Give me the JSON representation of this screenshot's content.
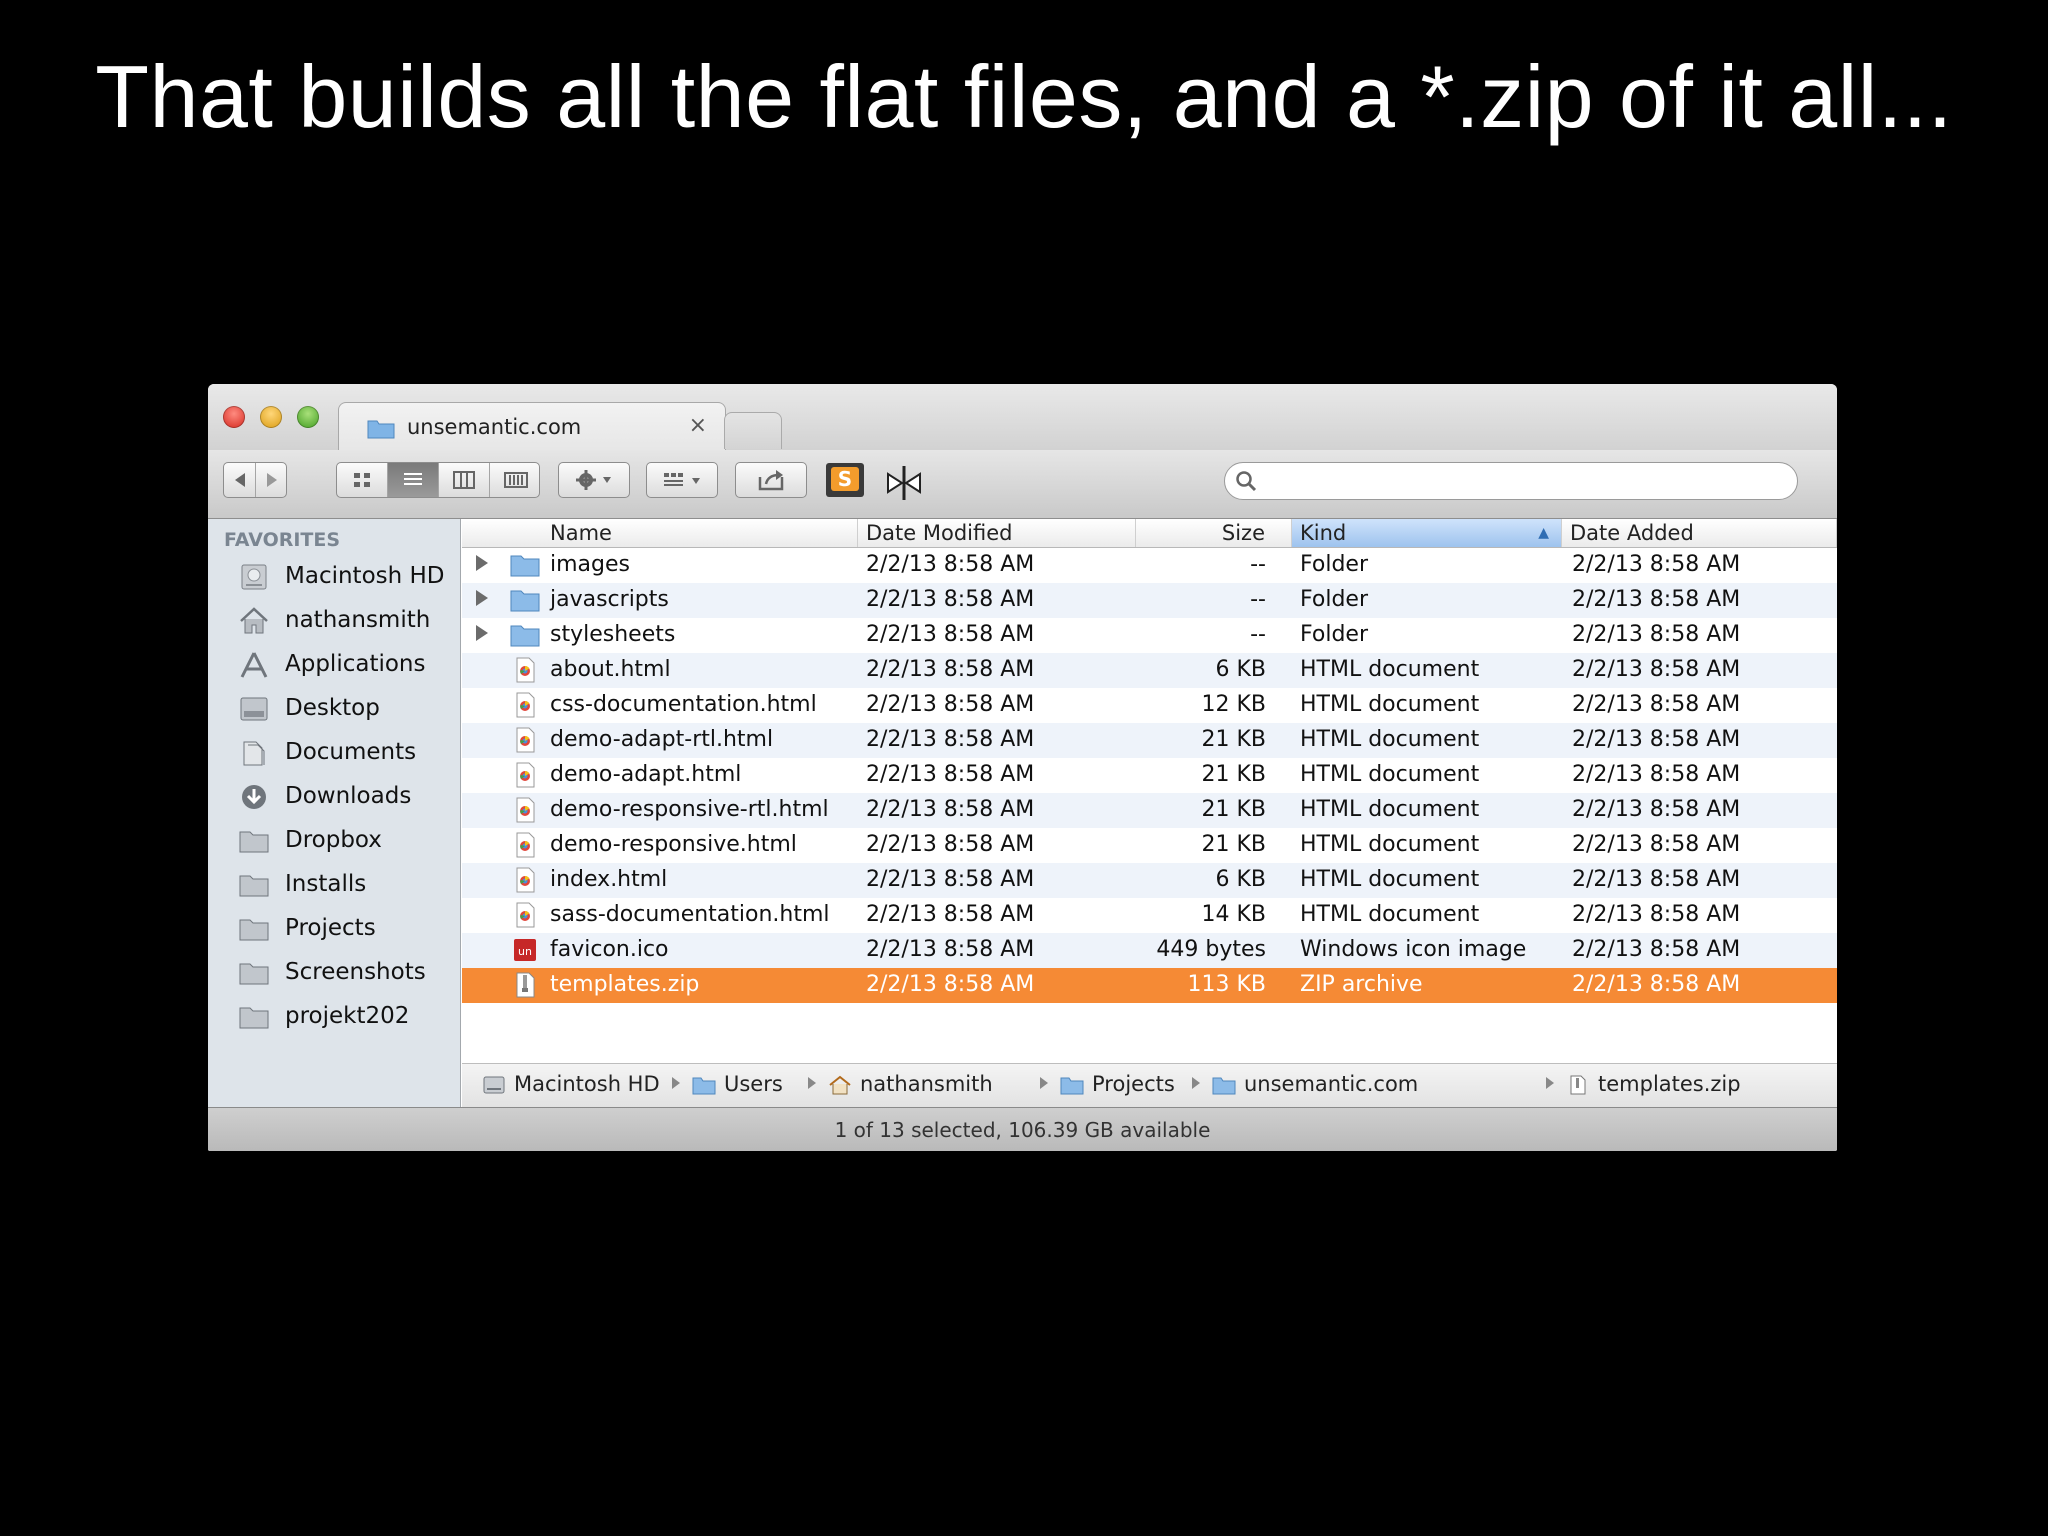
{
  "slide": {
    "title": "That builds all the flat files, and a *.zip of it all..."
  },
  "window": {
    "tab_title": "unsemantic.com",
    "tab_close": "×",
    "search_placeholder": ""
  },
  "sidebar": {
    "heading": "FAVORITES",
    "items": [
      {
        "label": "Macintosh HD",
        "icon": "hard-drive-icon"
      },
      {
        "label": "nathansmith",
        "icon": "home-icon"
      },
      {
        "label": "Applications",
        "icon": "applications-icon"
      },
      {
        "label": "Desktop",
        "icon": "desktop-icon"
      },
      {
        "label": "Documents",
        "icon": "documents-icon"
      },
      {
        "label": "Downloads",
        "icon": "downloads-icon"
      },
      {
        "label": "Dropbox",
        "icon": "folder-icon"
      },
      {
        "label": "Installs",
        "icon": "folder-icon"
      },
      {
        "label": "Projects",
        "icon": "folder-icon"
      },
      {
        "label": "Screenshots",
        "icon": "folder-icon"
      },
      {
        "label": "projekt202",
        "icon": "folder-icon"
      }
    ]
  },
  "list": {
    "columns": {
      "name": "Name",
      "date_modified": "Date Modified",
      "size": "Size",
      "kind": "Kind",
      "date_added": "Date Added"
    },
    "sorted_column": "Kind",
    "rows": [
      {
        "name": "images",
        "modified": "2/2/13 8:58 AM",
        "size": "--",
        "kind": "Folder",
        "added": "2/2/13 8:58 AM",
        "icon": "folder-icon"
      },
      {
        "name": "javascripts",
        "modified": "2/2/13 8:58 AM",
        "size": "--",
        "kind": "Folder",
        "added": "2/2/13 8:58 AM",
        "icon": "folder-icon"
      },
      {
        "name": "stylesheets",
        "modified": "2/2/13 8:58 AM",
        "size": "--",
        "kind": "Folder",
        "added": "2/2/13 8:58 AM",
        "icon": "folder-icon"
      },
      {
        "name": "about.html",
        "modified": "2/2/13 8:58 AM",
        "size": "6 KB",
        "kind": "HTML document",
        "added": "2/2/13 8:58 AM",
        "icon": "html-file-icon"
      },
      {
        "name": "css-documentation.html",
        "modified": "2/2/13 8:58 AM",
        "size": "12 KB",
        "kind": "HTML document",
        "added": "2/2/13 8:58 AM",
        "icon": "html-file-icon"
      },
      {
        "name": "demo-adapt-rtl.html",
        "modified": "2/2/13 8:58 AM",
        "size": "21 KB",
        "kind": "HTML document",
        "added": "2/2/13 8:58 AM",
        "icon": "html-file-icon"
      },
      {
        "name": "demo-adapt.html",
        "modified": "2/2/13 8:58 AM",
        "size": "21 KB",
        "kind": "HTML document",
        "added": "2/2/13 8:58 AM",
        "icon": "html-file-icon"
      },
      {
        "name": "demo-responsive-rtl.html",
        "modified": "2/2/13 8:58 AM",
        "size": "21 KB",
        "kind": "HTML document",
        "added": "2/2/13 8:58 AM",
        "icon": "html-file-icon"
      },
      {
        "name": "demo-responsive.html",
        "modified": "2/2/13 8:58 AM",
        "size": "21 KB",
        "kind": "HTML document",
        "added": "2/2/13 8:58 AM",
        "icon": "html-file-icon"
      },
      {
        "name": "index.html",
        "modified": "2/2/13 8:58 AM",
        "size": "6 KB",
        "kind": "HTML document",
        "added": "2/2/13 8:58 AM",
        "icon": "html-file-icon"
      },
      {
        "name": "sass-documentation.html",
        "modified": "2/2/13 8:58 AM",
        "size": "14 KB",
        "kind": "HTML document",
        "added": "2/2/13 8:58 AM",
        "icon": "html-file-icon"
      },
      {
        "name": "favicon.ico",
        "modified": "2/2/13 8:58 AM",
        "size": "449 bytes",
        "kind": "Windows icon image",
        "added": "2/2/13 8:58 AM",
        "icon": "ico-file-icon"
      },
      {
        "name": "templates.zip",
        "modified": "2/2/13 8:58 AM",
        "size": "113 KB",
        "kind": "ZIP archive",
        "added": "2/2/13 8:58 AM",
        "icon": "zip-file-icon",
        "selected": true
      }
    ]
  },
  "pathbar": {
    "crumbs": [
      {
        "label": "Macintosh HD",
        "icon": "hard-drive-icon"
      },
      {
        "label": "Users",
        "icon": "folder-icon"
      },
      {
        "label": "nathansmith",
        "icon": "home-icon"
      },
      {
        "label": "Projects",
        "icon": "folder-icon"
      },
      {
        "label": "unsemantic.com",
        "icon": "folder-icon"
      },
      {
        "label": "templates.zip",
        "icon": "zip-file-icon"
      }
    ]
  },
  "status": {
    "text": "1 of 13 selected, 106.39 GB available"
  },
  "colors": {
    "selection": "#f58a35",
    "sidebar_bg": "#dee4ea",
    "sort_header": "#9ec3ee"
  }
}
